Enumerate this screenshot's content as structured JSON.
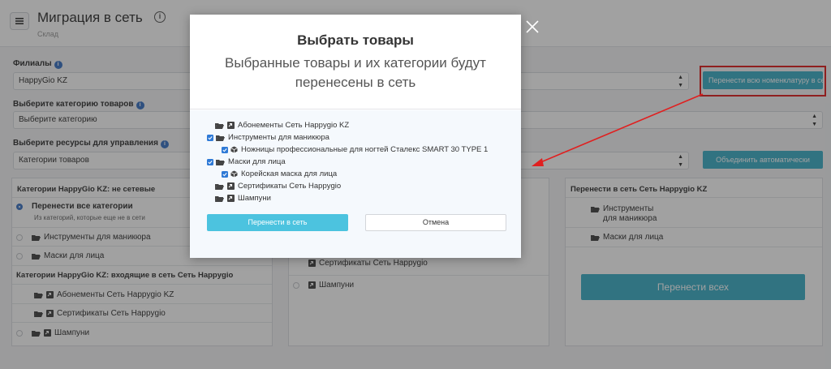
{
  "header": {
    "title": "Миграция в сеть",
    "subtitle": "Склад"
  },
  "form": {
    "branches_label": "Филиалы",
    "branch_value": "HappyGio KZ",
    "category_label": "Выберите категорию товаров",
    "category_value": "Выберите категорию",
    "resources_label": "Выберите ресурсы для управления",
    "resources_value": "Категории товаров",
    "transfer_all_nomenclature_label": "Перенести всю номенклатуру в се",
    "merge_auto_label": "Объединить автоматически"
  },
  "left_panel": {
    "title": "Категории HappyGio KZ: не сетевые",
    "transfer_all": "Перенести все категории",
    "transfer_all_sub": "Из категорий, которые еще не в сети",
    "items": [
      "Инструменты для маникюра",
      "Маски для лица"
    ],
    "incoming_title": "Категории HappyGio KZ: входящие в сеть Сеть Happygio",
    "incoming_items": [
      "Абонементы Сеть Happygio KZ",
      "Сертификаты Сеть Happygio",
      "Шампуни"
    ]
  },
  "middle_panel": {
    "items": [
      "Сертификаты Сеть Happygio",
      "Шампуни"
    ]
  },
  "right_panel": {
    "title": "Перенести в сеть Сеть Happygio KZ",
    "items": [
      "Инструменты для маникюра",
      "Маски для лица"
    ],
    "transfer_all_button": "Перенести всех"
  },
  "modal": {
    "title": "Выбрать товары",
    "subtitle": "Выбранные товары и их категории будут перенесены в сеть",
    "tree": {
      "item1": "Абонементы Сеть Happygio KZ",
      "item2": "Инструменты для маникюра",
      "item2_child": "Ножницы профессиональные для ногтей Сталекс SMART 30 TYPE 1",
      "item3": "Маски для лица",
      "item3_child": "Корейская маска для лица",
      "item4": "Сертификаты Сеть Happygio",
      "item5": "Шампуни"
    },
    "confirm_label": "Перенести в сеть",
    "cancel_label": "Отмена"
  },
  "colors": {
    "accent": "#3fb0c9",
    "checkbox": "#2f7ad6",
    "annotation": "#e02020"
  }
}
